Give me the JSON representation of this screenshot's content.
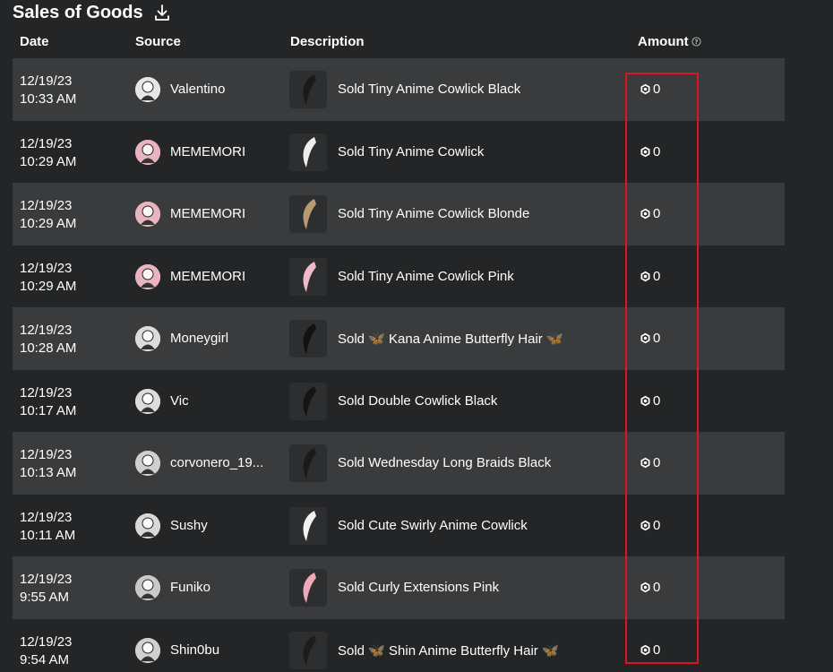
{
  "page": {
    "title": "Sales of Goods",
    "icons": {
      "download": "download-icon",
      "help": "help-circle-icon",
      "currency": "robux-icon"
    }
  },
  "table": {
    "columns": {
      "date": "Date",
      "source": "Source",
      "description": "Description",
      "amount": "Amount"
    },
    "rows": [
      {
        "date": "12/19/23",
        "time": "10:33 AM",
        "source": "Valentino",
        "verb": "Sold",
        "item": "Tiny Anime Cowlick Black",
        "amount": "0",
        "thumb_color": "#1a1a1a",
        "avatar_color": "#e6e6e6"
      },
      {
        "date": "12/19/23",
        "time": "10:29 AM",
        "source": "MEMEMORI",
        "verb": "Sold",
        "item": "Tiny Anime Cowlick",
        "amount": "0",
        "thumb_color": "#eeeeee",
        "avatar_color": "#e8b4c0"
      },
      {
        "date": "12/19/23",
        "time": "10:29 AM",
        "source": "MEMEMORI",
        "verb": "Sold",
        "item": "Tiny Anime Cowlick Blonde",
        "amount": "0",
        "thumb_color": "#b89a72",
        "avatar_color": "#e8b4c0"
      },
      {
        "date": "12/19/23",
        "time": "10:29 AM",
        "source": "MEMEMORI",
        "verb": "Sold",
        "item": "Tiny Anime Cowlick Pink",
        "amount": "0",
        "thumb_color": "#f0b8c8",
        "avatar_color": "#e8b4c0"
      },
      {
        "date": "12/19/23",
        "time": "10:28 AM",
        "source": "Moneygirl",
        "verb": "Sold",
        "item": "🦋 Kana Anime Butterfly Hair 🦋",
        "amount": "0",
        "thumb_color": "#111111",
        "avatar_color": "#dcdcdc"
      },
      {
        "date": "12/19/23",
        "time": "10:17 AM",
        "source": "Vic",
        "verb": "Sold",
        "item": "Double Cowlick Black",
        "amount": "0",
        "thumb_color": "#141414",
        "avatar_color": "#dcdcdc"
      },
      {
        "date": "12/19/23",
        "time": "10:13 AM",
        "source": "corvonero_19...",
        "verb": "Sold",
        "item": "Wednesday Long Braids Black",
        "amount": "0",
        "thumb_color": "#1a1a1a",
        "avatar_color": "#cfcfcf"
      },
      {
        "date": "12/19/23",
        "time": "10:11 AM",
        "source": "Sushy",
        "verb": "Sold",
        "item": "Cute Swirly Anime Cowlick",
        "amount": "0",
        "thumb_color": "#f2f2f2",
        "avatar_color": "#d8d8d8"
      },
      {
        "date": "12/19/23",
        "time": "9:55 AM",
        "source": "Funiko",
        "verb": "Sold",
        "item": "Curly Extensions Pink",
        "amount": "0",
        "thumb_color": "#f0a8b8",
        "avatar_color": "#c9c9c9"
      },
      {
        "date": "12/19/23",
        "time": "9:54 AM",
        "source": "Shin0bu",
        "verb": "Sold",
        "item": "🦋 Shin Anime Butterfly Hair 🦋",
        "amount": "0",
        "thumb_color": "#1c1c1c",
        "avatar_color": "#d0d0d0"
      }
    ]
  },
  "colors": {
    "background": "#232527",
    "row_alt": "#393b3d",
    "text": "#ffffff",
    "highlight": "#e0141e"
  }
}
